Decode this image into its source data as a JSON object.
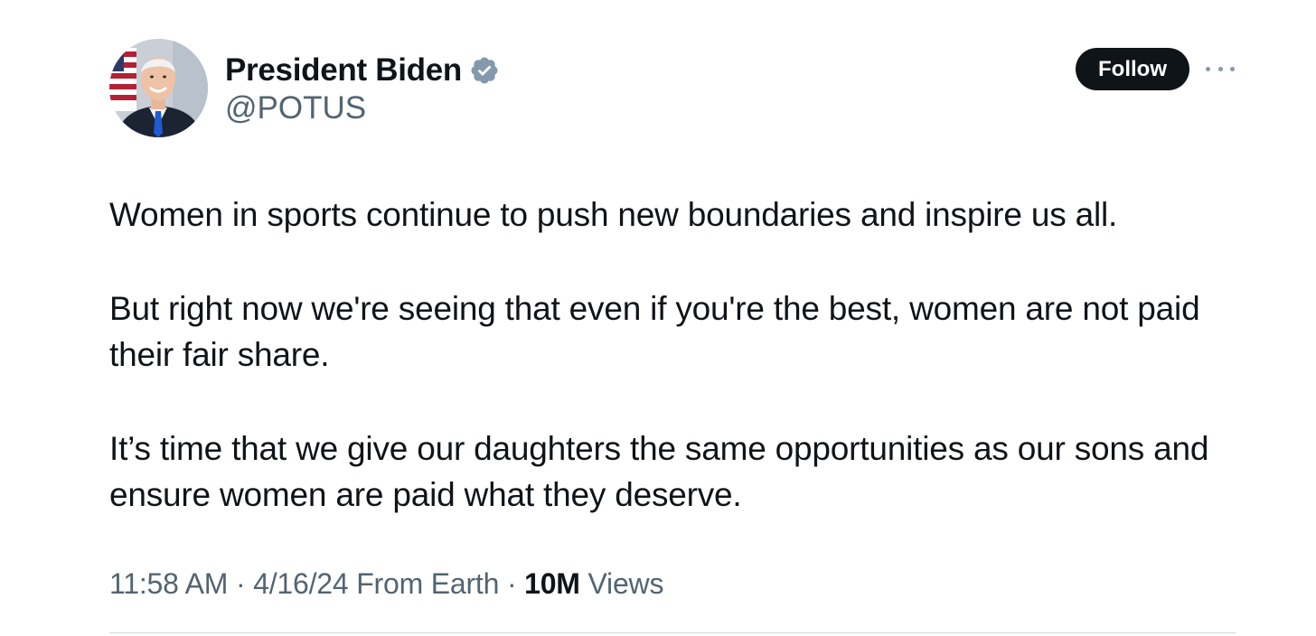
{
  "author": {
    "display_name": "President Biden",
    "handle": "@POTUS",
    "verified_badge_color": "#829aab"
  },
  "actions": {
    "follow_label": "Follow",
    "more_icon": "more-horizontal-icon"
  },
  "tweet": {
    "paragraphs": [
      "Women in sports continue to push new boundaries and inspire us all.",
      "But right now we're seeing that even if you're the best, women are not paid their fair share.",
      "It’s time that we give our daughters the same opportunities as our sons and ensure women are paid what they deserve."
    ]
  },
  "meta": {
    "time": "11:58 AM",
    "separator": "·",
    "date": "4/16/24",
    "source": "From Earth",
    "views_count": "10M",
    "views_label": "Views"
  },
  "colors": {
    "text_primary": "#0f1419",
    "text_secondary": "#536471",
    "follow_bg": "#0f1419",
    "divider": "#cfd9de"
  }
}
